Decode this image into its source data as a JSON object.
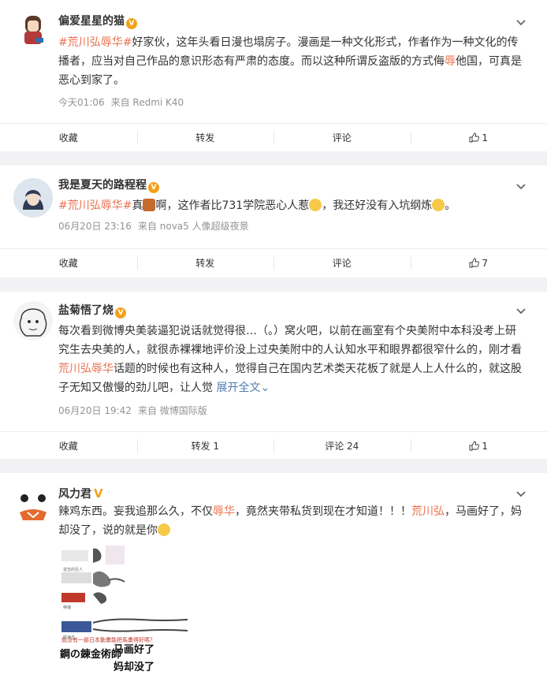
{
  "posts": [
    {
      "name": "偏爱星星的猫",
      "vip_badge": "V",
      "text_parts": [
        "#荒川弘辱华#",
        "好家伙，这年头看日漫也塌房子。漫画是一种文化形式，作者作为一种文化的传播者，应当对自己作品的意识形态有严肃的态度。而以这种所谓反盗版的方式侮",
        "辱",
        "他国，可真是恶心到家了。"
      ],
      "time": "今天01:06",
      "source": "来自 Redmi K40",
      "actions": {
        "collect": "收藏",
        "repost": "转发",
        "comment": "评论",
        "like": "1"
      }
    },
    {
      "name": "我是夏天的路程程",
      "vip_badge": "V",
      "text_parts": [
        "#荒川弘辱华#",
        "真",
        "啊，这作者比731学院恶心人惹",
        "，我还好没有入坑纲炼",
        "。"
      ],
      "time": "06月20日 23:16",
      "source": "来自 nova5 人像超级夜景",
      "actions": {
        "collect": "收藏",
        "repost": "转发",
        "comment": "评论",
        "like": "7"
      }
    },
    {
      "name": "盐菊悟了烧",
      "vip_badge": "V",
      "text_parts": [
        "每次看到微博央美装逼犯说话就觉得很…（。）窝火吧，以前在画室有个央美附中本科没考上研究生去央美的人，就很赤裸裸地评价没上过央美附中的人认知水平和眼界都很窄什么的，刚才看",
        "荒川弘辱华",
        "话题的时候也有这种人，觉得自己在国内艺术类天花板了就是人上人什么的，就这股子无知又傲慢的劲儿吧，让人觉 ",
        "展开全文",
        "⌄"
      ],
      "time": "06月20日 19:42",
      "source": "来自 微博国际版",
      "actions": {
        "collect": "收藏",
        "repost": "转发 1",
        "comment": "评论 24",
        "like": "1"
      }
    },
    {
      "name": "风力君",
      "vip_badge": "V",
      "text_parts": [
        "辣鸡东西。妄我追那么久，不仅",
        "辱华",
        "，竟然夹带私货到现在才知道！！！",
        "荒川弘",
        "，马画好了，妈却没了，说的就是你"
      ],
      "image_texts": [
        "就没有一部日本動畫能把馬畫得好嗎？",
        "鋼の錬金術師",
        "马画好了",
        "妈却没了",
        "进击的巨人",
        "航海王",
        "棋魂"
      ]
    }
  ],
  "colors": {
    "accent": "#eb7350",
    "link": "#507daf",
    "vip": "#f4a11a"
  }
}
